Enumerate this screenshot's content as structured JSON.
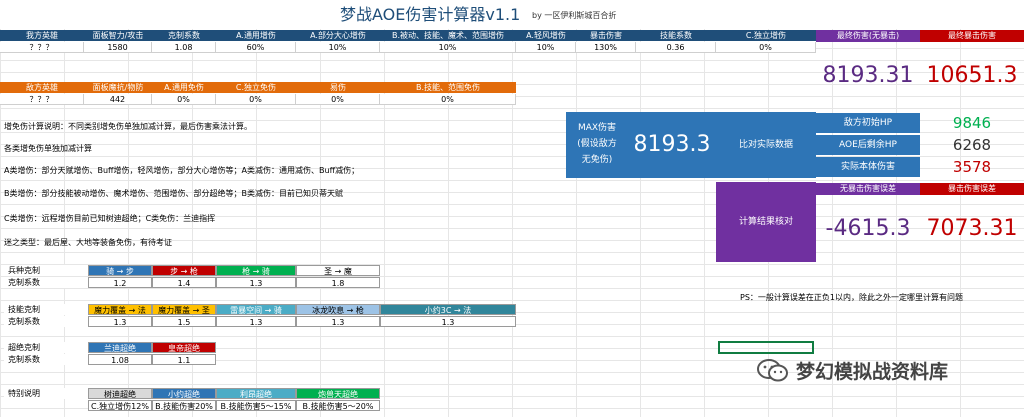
{
  "title": "梦战AOE伤害计算器v1.1",
  "byline": "by 一区伊利斯城百合折",
  "attacker": {
    "headers": [
      "我方英雄",
      "面板智力/攻击",
      "克制系数",
      "A.通用增伤",
      "A.部分大心增伤",
      "B.被动、技能、魔术、范围增伤",
      "A.轻风增伤",
      "暴击伤害",
      "技能系数",
      "C.独立增伤"
    ],
    "values": [
      "？？？",
      "1580",
      "1.08",
      "60%",
      "10%",
      "10%",
      "10%",
      "130%",
      "0.36",
      "0%"
    ]
  },
  "defender": {
    "headers": [
      "敌方英雄",
      "面板魔抗/物防",
      "A.通用免伤",
      "C.独立免伤",
      "易伤",
      "B.技能、范围免伤"
    ],
    "values": [
      "？？？",
      "442",
      "0%",
      "0%",
      "0%",
      "0%"
    ]
  },
  "results": {
    "final_label": "最终伤害(无暴击)",
    "final_crit_label": "最终暴击伤害",
    "final_value": "8193.31",
    "final_crit_value": "10651.3",
    "max_label_lines": [
      "MAX伤害",
      "(假设敌方",
      "无免伤)"
    ],
    "max_value": "8193.3",
    "compare_label": "比对实际数据",
    "enemy_hp_label": "敌方初始HP",
    "enemy_hp_value": "9846",
    "after_aoe_label": "AOE后剩余HP",
    "after_aoe_value": "6268",
    "actual_label": "实际本体伤害",
    "actual_value": "3578",
    "verify_label": "计算结果核对",
    "err_label": "无暴击伤害误差",
    "err_crit_label": "暴击伤害误差",
    "err_value": "-4615.3",
    "err_crit_value": "7073.31"
  },
  "notes": [
    "增免伤计算说明：不同类别增免伤单独加减计算，最后伤害乘法计算。",
    "各类增免伤单独加减计算",
    "A类增伤：部分天赋增伤、Buff增伤，轻风增伤，部分大心增伤等；A类减伤：通用减伤、Buff减伤；",
    "B类增伤：部分技能被动增伤、魔术增伤、范围增伤、部分超绝等；B类减伤：目前已知贝蒂天赋",
    "C类增伤：远程增伤目前已知树迪超绝；C类免伤：兰迪指挥",
    "迷之类型：最后屋、大地等装备免伤，有待考证"
  ],
  "ps": "PS：一般计算误差在正负1以内，除此之外一定哪里计算有问题",
  "troop": {
    "label": "兵种克制",
    "coef_label": "克制系数",
    "tags": [
      "骑 → 步",
      "步 → 枪",
      "枪 → 骑",
      "圣 → 魔"
    ],
    "values": [
      "1.2",
      "1.4",
      "1.3",
      "1.8"
    ]
  },
  "skill": {
    "label": "技能克制",
    "coef_label": "克制系数",
    "tags": [
      "魔力覆盖 → 法",
      "魔力覆盖 → 圣",
      "雷暴空间 → 骑",
      "冰龙吹息 → 枪",
      "小约3C → 法"
    ],
    "values": [
      "1.3",
      "1.5",
      "1.3",
      "1.3",
      "1.3"
    ]
  },
  "ult": {
    "label": "超绝克制",
    "coef_label": "克制系数",
    "tags": [
      "兰迪超绝",
      "皇帝超绝"
    ],
    "values": [
      "1.08",
      "1.1"
    ]
  },
  "special": {
    "label": "特别说明",
    "tags": [
      "树迪超绝",
      "小约超绝",
      "利昂超绝",
      "炮兽天超绝"
    ],
    "values": [
      "C.独立增伤12%",
      "B.技能伤害20%",
      "B.技能伤害5～15%",
      "B.技能伤害5～20%"
    ]
  },
  "watermark": "梦幻模拟战资料库",
  "colors": {
    "header_blue": "#1f4e79",
    "header_orange": "#e26b0a",
    "purple": "#7030a0",
    "red": "#c00000",
    "green": "#00b050"
  }
}
